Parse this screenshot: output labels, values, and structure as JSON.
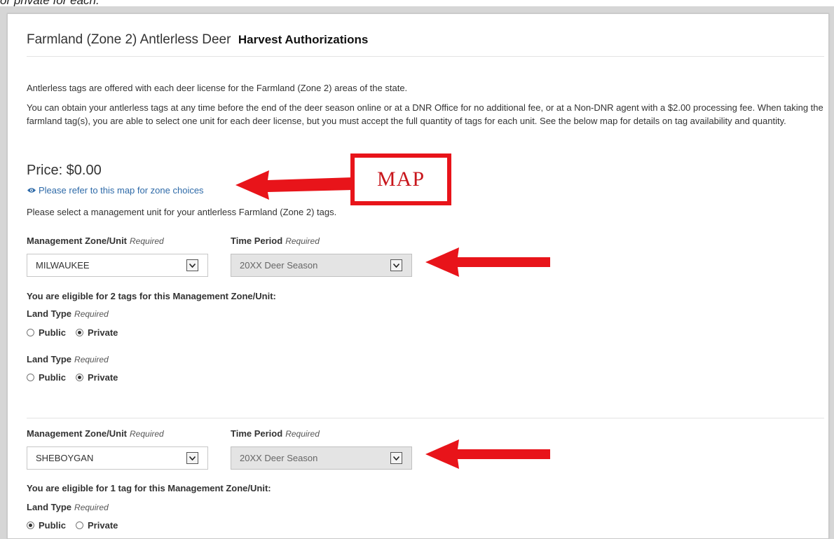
{
  "caption": "or private for each.",
  "panel": {
    "title_main": "Farmland (Zone 2) Antlerless Deer",
    "title_sub": "Harvest Authorizations",
    "intro": "Antlerless tags are offered with each deer license for the Farmland (Zone 2) areas of the state.",
    "details": "You can obtain your antlerless tags at any time before the end of the deer season online or at a DNR Office for no additional fee, or at a Non-DNR agent with a $2.00 processing fee. When taking the farmland tag(s), you are able to select one unit for each deer license, but you must accept the full quantity of tags for each unit. See the below map for details on tag availability and quantity.",
    "price": "Price: $0.00",
    "map_link": "Please refer to this map for zone choices",
    "select_prompt": "Please select a management unit for your antlerless Farmland (Zone 2) tags."
  },
  "annotation": {
    "label": "MAP",
    "color": "#e8141a"
  },
  "labels": {
    "zone": "Management Zone/Unit",
    "time": "Time Period",
    "required": "Required",
    "land_type": "Land Type",
    "public": "Public",
    "private": "Private"
  },
  "units": [
    {
      "zone_value": "MILWAUKEE",
      "time_value": "20XX Deer Season",
      "eligible": "You are eligible for 2 tags for this Management Zone/Unit:",
      "land_types": [
        "Private",
        "Private"
      ]
    },
    {
      "zone_value": "SHEBOYGAN",
      "time_value": "20XX Deer Season",
      "eligible": "You are eligible for 1 tag for this Management Zone/Unit:",
      "land_types": [
        "Public"
      ]
    }
  ],
  "colors": {
    "link": "#2e6aa8",
    "annotation": "#e8141a",
    "disabled_bg": "#e4e4e4"
  },
  "icons": {
    "map_link": "eye-icon",
    "dropdown": "chevron-down-icon"
  }
}
